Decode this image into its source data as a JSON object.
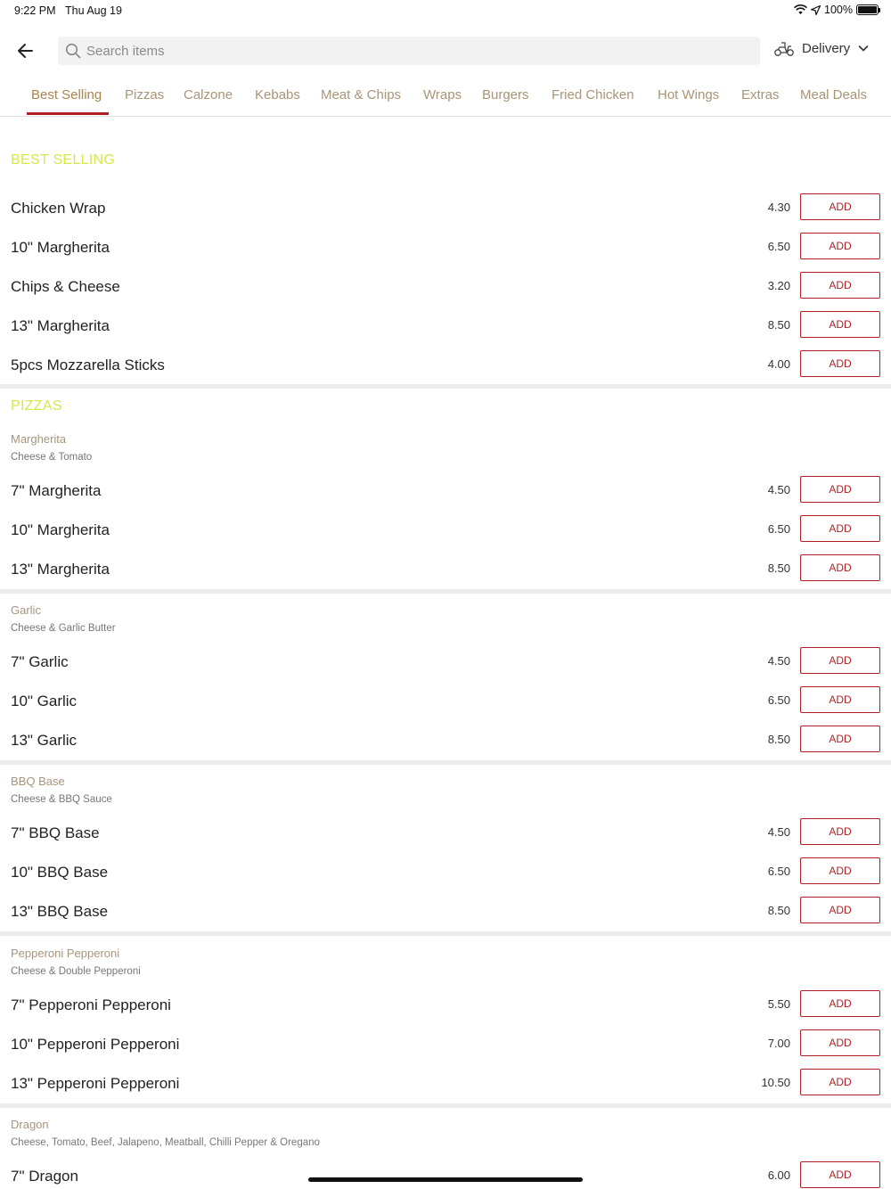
{
  "status": {
    "time": "9:22 PM",
    "date": "Thu Aug 19",
    "battery": "100%"
  },
  "search": {
    "placeholder": "Search items"
  },
  "delivery": {
    "label": "Delivery"
  },
  "tabs": [
    "Best Selling",
    "Pizzas",
    "Calzone",
    "Kebabs",
    "Meat & Chips",
    "Wraps",
    "Burgers",
    "Fried Chicken",
    "Hot Wings",
    "Extras",
    "Meal Deals"
  ],
  "active_tab": "Best Selling",
  "add_label": "ADD",
  "sections": [
    {
      "title": "BEST SELLING",
      "groups": [
        {
          "name": "",
          "description": "",
          "items": [
            {
              "name": "Chicken Wrap",
              "price": "4.30"
            },
            {
              "name": "10\" Margherita",
              "price": "6.50"
            },
            {
              "name": "Chips & Cheese",
              "price": "3.20"
            },
            {
              "name": "13\" Margherita",
              "price": "8.50"
            },
            {
              "name": "5pcs Mozzarella Sticks",
              "price": "4.00"
            }
          ]
        }
      ]
    },
    {
      "title": "PIZZAS",
      "groups": [
        {
          "name": "Margherita",
          "description": "Cheese & Tomato",
          "items": [
            {
              "name": "7\" Margherita",
              "price": "4.50"
            },
            {
              "name": "10\" Margherita",
              "price": "6.50"
            },
            {
              "name": "13\" Margherita",
              "price": "8.50"
            }
          ]
        },
        {
          "name": "Garlic",
          "description": "Cheese & Garlic Butter",
          "items": [
            {
              "name": "7\" Garlic",
              "price": "4.50"
            },
            {
              "name": "10\" Garlic",
              "price": "6.50"
            },
            {
              "name": "13\" Garlic",
              "price": "8.50"
            }
          ]
        },
        {
          "name": "BBQ Base",
          "description": "Cheese & BBQ Sauce",
          "items": [
            {
              "name": "7\" BBQ Base",
              "price": "4.50"
            },
            {
              "name": "10\" BBQ Base",
              "price": "6.50"
            },
            {
              "name": "13\" BBQ Base",
              "price": "8.50"
            }
          ]
        },
        {
          "name": "Pepperoni Pepperoni",
          "description": "Cheese & Double Pepperoni",
          "items": [
            {
              "name": "7\" Pepperoni Pepperoni",
              "price": "5.50"
            },
            {
              "name": "10\" Pepperoni Pepperoni",
              "price": "7.00"
            },
            {
              "name": "13\" Pepperoni Pepperoni",
              "price": "10.50"
            }
          ]
        },
        {
          "name": "Dragon",
          "description": "Cheese, Tomato, Beef, Jalapeno, Meatball, Chilli Pepper & Oregano",
          "items": [
            {
              "name": "7\" Dragon",
              "price": "6.00"
            }
          ]
        }
      ]
    }
  ]
}
